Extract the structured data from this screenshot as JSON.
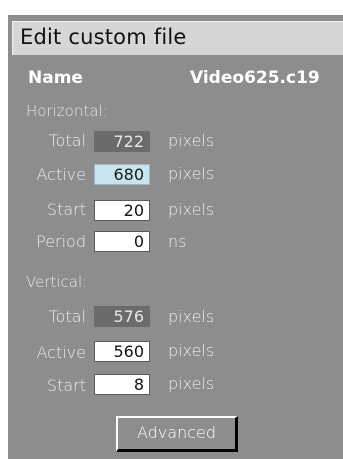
{
  "dialog": {
    "title": "Edit custom file",
    "name_label": "Name",
    "file_name": "Video625.c19"
  },
  "horizontal": {
    "heading": "Horizontal:",
    "rows": [
      {
        "label": "Total",
        "value": "722",
        "unit": "pixels",
        "state": "readonly"
      },
      {
        "label": "Active",
        "value": "680",
        "unit": "pixels",
        "state": "focused"
      },
      {
        "label": "Start",
        "value": "20",
        "unit": "pixels",
        "state": "editable"
      },
      {
        "label": "Period",
        "value": "0",
        "unit": "ns",
        "state": "editable"
      }
    ]
  },
  "vertical": {
    "heading": "Vertical:",
    "rows": [
      {
        "label": "Total",
        "value": "576",
        "unit": "pixels",
        "state": "readonly"
      },
      {
        "label": "Active",
        "value": "560",
        "unit": "pixels",
        "state": "editable"
      },
      {
        "label": "Start",
        "value": "8",
        "unit": "pixels",
        "state": "editable"
      }
    ]
  },
  "buttons": {
    "advanced_label": "Advanced"
  },
  "colors": {
    "panel_background": "#8d8d8d",
    "title_bar_background": "#d6d6d6",
    "readonly_field": "#6b6b6b",
    "focused_field": "#c8e4ef",
    "editable_field": "#ffffff"
  }
}
